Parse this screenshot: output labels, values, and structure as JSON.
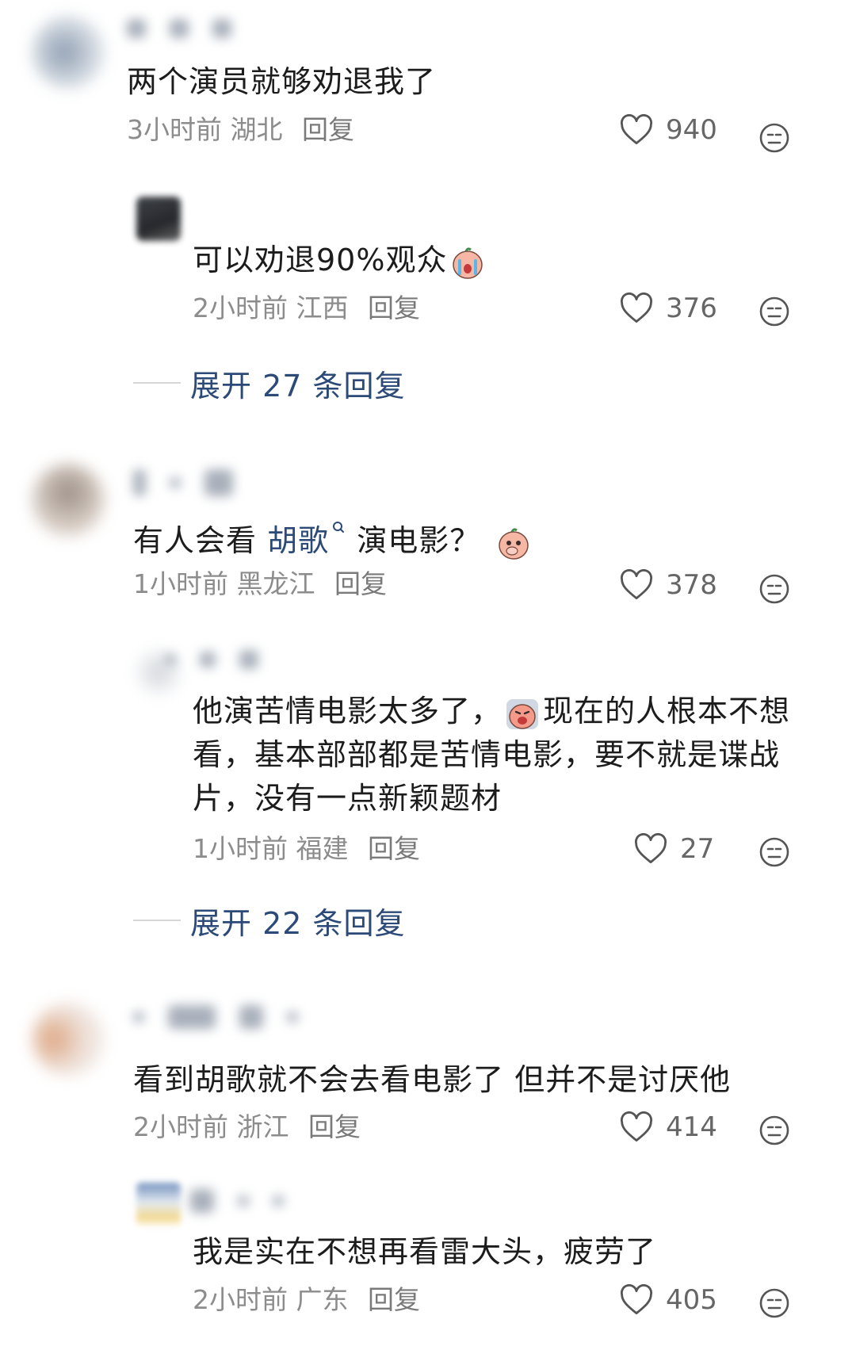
{
  "comments": [
    {
      "text": "两个演员就够劝退我了",
      "time": "3小时前",
      "location": "湖北",
      "reply": "回复",
      "likes": "940",
      "replies": [
        {
          "text": "可以劝退90%观众",
          "emoji": "crying-peach-emoji",
          "time": "2小时前",
          "location": "江西",
          "reply": "回复",
          "likes": "376"
        }
      ],
      "expand": "展开 27 条回复"
    },
    {
      "text_before": "有人会看 ",
      "topic": "胡歌",
      "topic_icon": "search-icon",
      "text_after": " 演电影？",
      "emoji": "covering-mouth-peach-emoji",
      "time": "1小时前",
      "location": "黑龙江",
      "reply": "回复",
      "likes": "378",
      "replies": [
        {
          "text_before": "他演苦情电影太多了，",
          "emoji": "exasperated-peach-emoji",
          "text_after": "现在的人根本不想看，基本部部都是苦情电影，要不就是谍战片，没有一点新颖题材",
          "time": "1小时前",
          "location": "福建",
          "reply": "回复",
          "likes": "27"
        }
      ],
      "expand": "展开 22 条回复"
    },
    {
      "text": "看到胡歌就不会去看电影了 但并不是讨厌他",
      "time": "2小时前",
      "location": "浙江",
      "reply": "回复",
      "likes": "414",
      "replies": [
        {
          "text": "我是实在不想再看雷大头，疲劳了",
          "time": "2小时前",
          "location": "广东",
          "reply": "回复",
          "likes": "405"
        }
      ]
    }
  ],
  "colors": {
    "link": "#2c4a78",
    "meta": "#8c8c8c",
    "text": "#1c1c1c"
  }
}
